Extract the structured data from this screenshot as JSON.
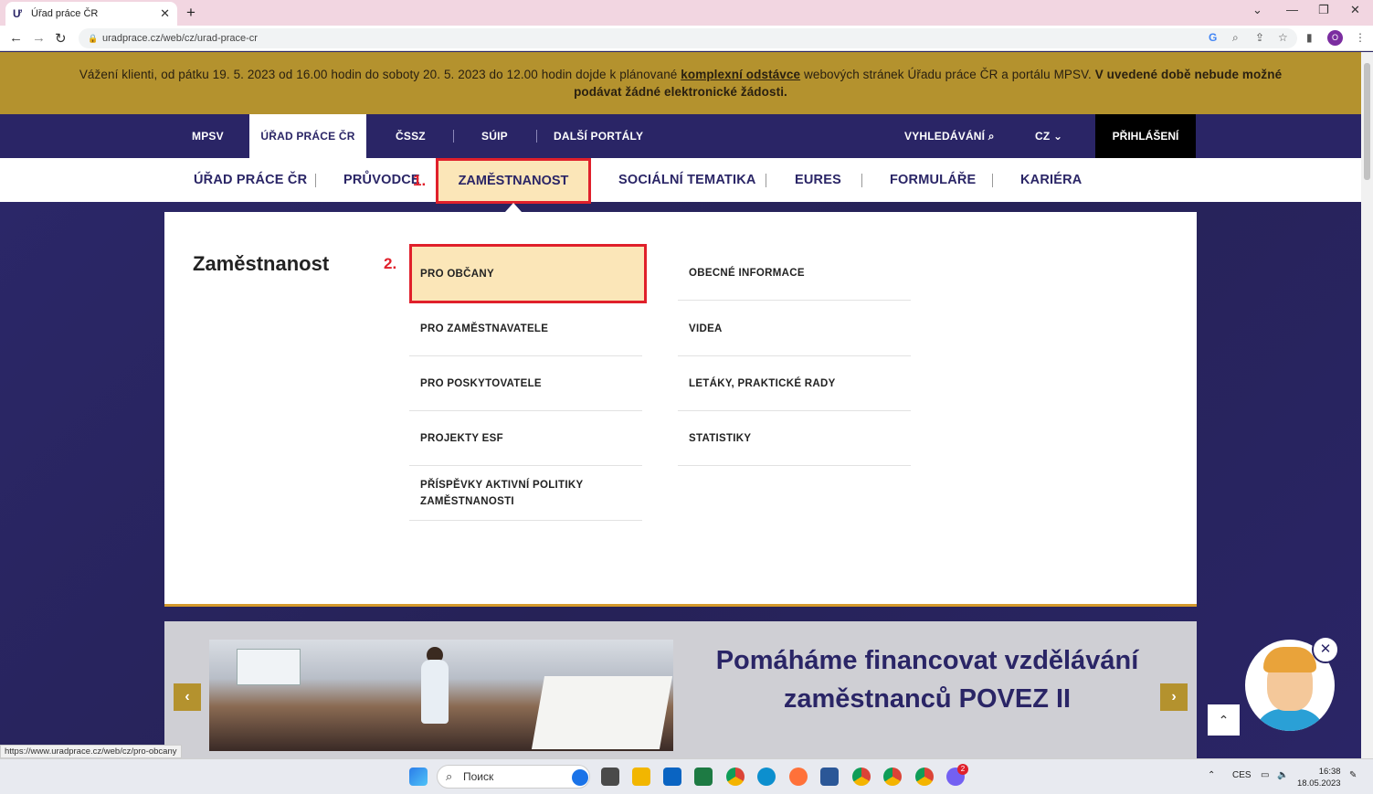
{
  "browser": {
    "tab_title": "Úřad práce ČR",
    "url": "uradprace.cz/web/cz/urad-prace-cr",
    "profile_initial": "O",
    "status_link": "https://www.uradprace.cz/web/cz/pro-obcany"
  },
  "notice": {
    "text_before": "Vážení klienti, od pátku 19. 5. 2023 od 16.00 hodin do soboty 20. 5. 2023 do 12.00 hodin dojde k plánované ",
    "link": "komplexní odstávce",
    "text_after": "  webových stránek Úřadu práce ČR a portálu MPSV. ",
    "bold_text": "V uvedené době nebude možné podávat žádné elektronické žádosti."
  },
  "top_nav": {
    "items": [
      "MPSV",
      "ÚŘAD PRÁCE ČR",
      "ČSSZ",
      "SÚIP",
      "DALŠÍ PORTÁLY"
    ],
    "search": "VYHLEDÁVÁNÍ",
    "lang": "CZ",
    "login": "PŘIHLÁŠENÍ"
  },
  "sec_nav": {
    "items": [
      "ÚŘAD PRÁCE ČR",
      "PRŮVODCE",
      "ZAMĚSTNANOST",
      "SOCIÁLNÍ TEMATIKA",
      "EURES",
      "FORMULÁŘE",
      "KARIÉRA"
    ],
    "step1": "1.",
    "step2": "2."
  },
  "mega_menu": {
    "title": "Zaměstnanost",
    "col1": [
      "PRO OBČANY",
      "PRO ZAMĚSTNAVATELE",
      "PRO POSKYTOVATELE",
      "PROJEKTY ESF",
      "PŘÍSPĚVKY AKTIVNÍ POLITIKY ZAMĚSTNANOSTI"
    ],
    "col2": [
      "OBECNÉ INFORMACE",
      "VIDEA",
      "LETÁKY, PRAKTICKÉ RADY",
      "STATISTIKY"
    ]
  },
  "carousel": {
    "title": "Pomáháme financovat vzdělávání zaměstnanců POVEZ II"
  },
  "taskbar": {
    "search_placeholder": "Поиск",
    "lang": "CES",
    "time": "16:38",
    "date": "18.05.2023",
    "badge": "2"
  }
}
